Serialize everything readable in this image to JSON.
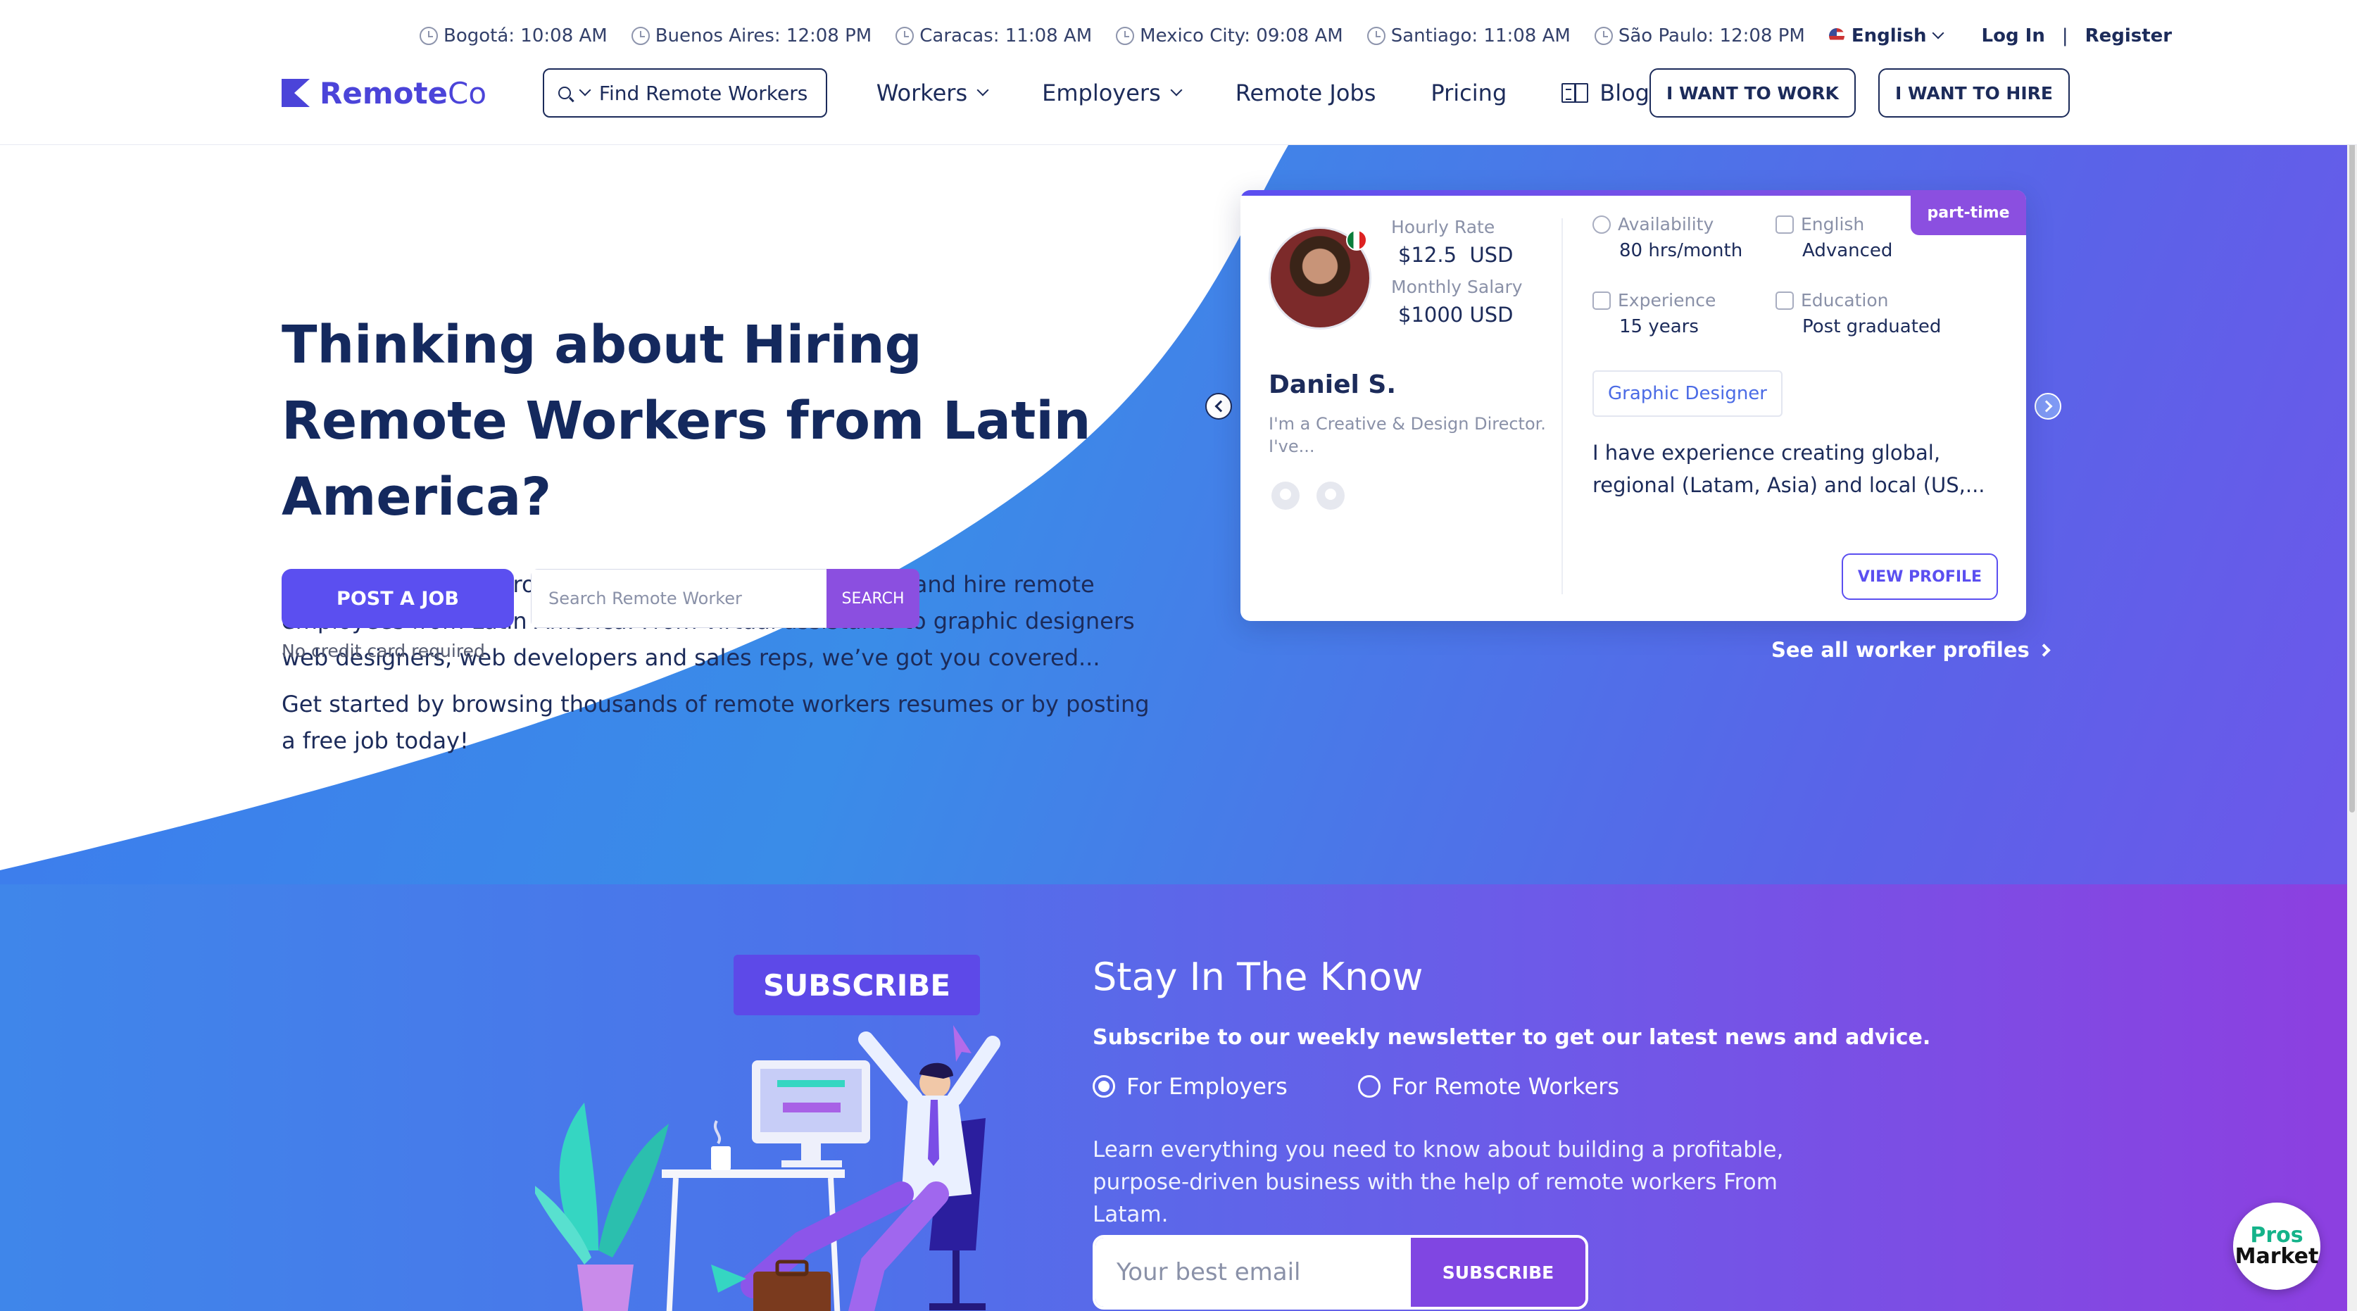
{
  "topbar": {
    "clocks": [
      {
        "label": "Bogotá: 10:08 AM"
      },
      {
        "label": "Buenos Aires: 12:08 PM"
      },
      {
        "label": "Caracas: 11:08 AM"
      },
      {
        "label": "Mexico City: 09:08 AM"
      },
      {
        "label": "Santiago: 11:08 AM"
      },
      {
        "label": "São Paulo: 12:08 PM"
      }
    ],
    "language": "English",
    "login": "Log In",
    "separator": "|",
    "register": "Register"
  },
  "nav": {
    "logo_main": "Remote",
    "logo_co": "Co",
    "find_label": "Find Remote Workers",
    "workers": "Workers",
    "employers": "Employers",
    "remote_jobs": "Remote Jobs",
    "pricing": "Pricing",
    "blog": "Blog",
    "want_work": "I WANT TO WORK",
    "want_hire": "I WANT TO HIRE"
  },
  "hero": {
    "title": "Thinking about Hiring Remote Workers from Latin America?",
    "p1": "We help employers from a diverse set of industries find and hire remote employees from Latin America. From virtual assistants to graphic designers web designers, web developers and sales reps, we’ve got you covered...",
    "p2": "Get started by browsing thousands of remote workers resumes or by posting a free job today!",
    "post_job": "POST A JOB",
    "search_placeholder": "Search Remote Worker",
    "search_btn": "SEARCH",
    "no_cc": "No credit card required"
  },
  "card": {
    "badge": "part-time",
    "hourly_label": "Hourly Rate",
    "hourly_value": "$12.5  USD",
    "monthly_label": "Monthly Salary",
    "monthly_value": "$1000 USD",
    "name": "Daniel S.",
    "desc": "I'm a Creative & Design Director. I've...",
    "availability_label": "Availability",
    "availability_value": "80 hrs/month",
    "english_label": "English",
    "english_value": "Advanced",
    "experience_label": "Experience",
    "experience_value": "15 years",
    "education_label": "Education",
    "education_value": "Post graduated",
    "tag": "Graphic Designer",
    "text": "I have experience creating global, regional (Latam, Asia) and local (US,...",
    "view_profile": "VIEW PROFILE",
    "see_all": "See all worker profiles"
  },
  "newsletter": {
    "badge": "SUBSCRIBE",
    "title": "Stay In The Know",
    "subtitle": "Subscribe to our weekly newsletter to get our latest news and advice.",
    "radio_employers": "For Employers",
    "radio_workers": "For Remote Workers",
    "desc": "Learn everything you need to know about building a profitable, purpose-driven business with the help of remote workers From Latam.",
    "email_placeholder": "Your best email",
    "subscribe_btn": "SUBSCRIBE"
  },
  "widget": {
    "line1": "Pros",
    "line2": "Market"
  },
  "colors": {
    "brand": "#4b44d9",
    "primary_button": "#5b4ff0",
    "accent_purple": "#8b4fe0",
    "navy_text": "#1c2b5a"
  }
}
